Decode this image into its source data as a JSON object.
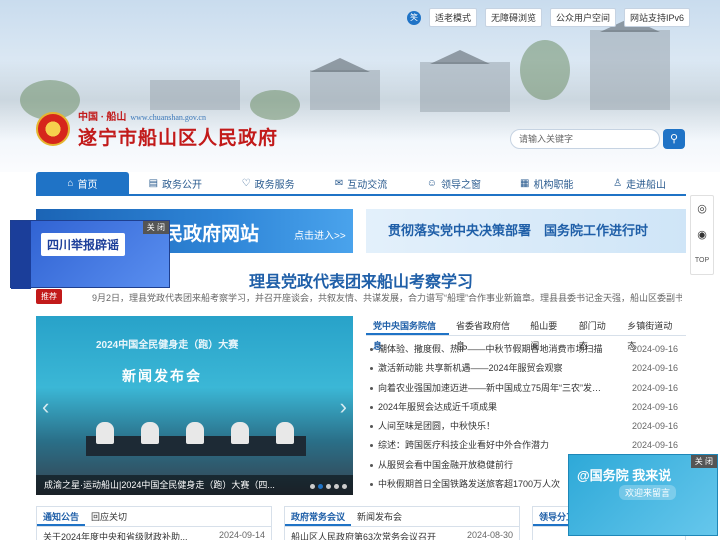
{
  "header": {
    "top_buttons": [
      "适老模式",
      "无障碍浏览",
      "公众用户空间",
      "网站支持IPv6"
    ],
    "wechat_icon": "笑",
    "logo_prefix": "中国 · 船山",
    "logo_url": "www.chuanshan.gov.cn",
    "site_title": "遂宁市船山区人民政府",
    "search_placeholder": "请输入关键字"
  },
  "nav": [
    {
      "label": "首页",
      "icon": "home-icon",
      "glyph": "⌂"
    },
    {
      "label": "政务公开",
      "icon": "document-icon",
      "glyph": "▤"
    },
    {
      "label": "政务服务",
      "icon": "heart-icon",
      "glyph": "♡"
    },
    {
      "label": "互动交流",
      "icon": "chat-icon",
      "glyph": "✉"
    },
    {
      "label": "领导之窗",
      "icon": "user-icon",
      "glyph": "☺"
    },
    {
      "label": "机构职能",
      "icon": "org-icon",
      "glyph": "▦"
    },
    {
      "label": "走进船山",
      "icon": "person-icon",
      "glyph": "♙"
    }
  ],
  "banners": {
    "left_big": "民政府网站",
    "left_small": "点击进入>>",
    "right": "贯彻落实党中央决策部署　国务院工作进行时"
  },
  "popup_left": {
    "close": "关 闭",
    "title": "四川举报辟谣"
  },
  "headline": {
    "title": "理县党政代表团来船山考察学习",
    "tag": "推荐",
    "summary": "9月2日，理县党政代表团来船考察学习，并召开座谈会，共叙友情、共谋发展，合力谱写“船理”合作事业新篇章。理县县委书记金天强，船山区委副书记、区长陈绍..."
  },
  "slide": {
    "caption": "成渝之星·运动船山|2024中国全民健身走（跑）大赛（四...",
    "top_text": "2024中国全民健身走（跑）大赛",
    "press": "新闻发布会",
    "active_dot": 1
  },
  "news": {
    "tabs": [
      "党中央国务院信息",
      "省委省政府信息",
      "船山要闻",
      "部门动态",
      "乡镇街道动态"
    ],
    "items": [
      {
        "title": "潮体验、撒度假、热IP——中秋节假期各地消费市场扫描",
        "date": "2024-09-16"
      },
      {
        "title": "激活新动能 共享新机遇——2024年服贸会观察",
        "date": "2024-09-16"
      },
      {
        "title": "向着农业强国加速迈进——新中国成立75周年“三农”发展成就...",
        "date": "2024-09-16"
      },
      {
        "title": "2024年服贸会达成近千项成果",
        "date": "2024-09-16"
      },
      {
        "title": "人间至味是团圆，中秋快乐！",
        "date": "2024-09-16"
      },
      {
        "title": "综述：跨国医疗科技企业看好中外合作潜力",
        "date": "2024-09-16"
      },
      {
        "title": "从服贸会看中国金融开放稳健前行",
        "date": "2024-09-16"
      },
      {
        "title": "中秋假期首日全国铁路发送旅客超1700万人次",
        "date": "2024-09-16"
      }
    ]
  },
  "bottom": {
    "box1": {
      "tabs": [
        "通知公告",
        "回应关切"
      ],
      "row": {
        "title": "关于2024年度中央和省级财政补助...",
        "date": "2024-09-14"
      }
    },
    "box2": {
      "tabs": [
        "政府常务会议",
        "新闻发布会"
      ],
      "row": {
        "title": "船山区人民政府第63次常务会议召开",
        "date": "2024-08-30"
      }
    },
    "box3": {
      "tabs": [
        "领导分工"
      ]
    }
  },
  "side_tools": [
    "wechat-icon",
    "weibo-icon"
  ],
  "side_top": "TOP",
  "popup_right": {
    "close": "关 闭",
    "title": "@国务院 我来说",
    "sub": "欢迎来留言"
  }
}
